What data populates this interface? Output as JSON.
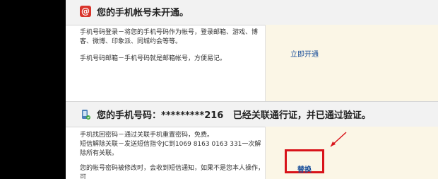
{
  "section1": {
    "icon": "at-sign-icon",
    "title": "您的手机帐号未开通。",
    "desc1": "手机号码登录－将您的手机号码作为帐号，登录邮箱、游戏、博客、微博、印象派、同城约会等等。",
    "desc2": "手机号码邮箱－手机号码就是邮箱帐号，方便易记。",
    "action_label": "立即开通"
  },
  "section2": {
    "icon": "phone-verified-icon",
    "title_prefix": "您的手机号码：",
    "phone": "*********216",
    "title_suffix": "已经关联通行证，并已通过验证。",
    "desc1": "手机找回密码－通过关联手机重置密码，免费。",
    "desc2": "短信解除关联－发送短信指令JC到1069 8163 0163 331一次解除所有关联。",
    "desc3": "您的帐号密码被修改时，会收到短信通知，如果不是您本人操作，可",
    "action_label": "替换"
  },
  "colors": {
    "highlight": "#d8131a",
    "link": "#1a4f9a",
    "action_bg": "#fbf6e6"
  }
}
